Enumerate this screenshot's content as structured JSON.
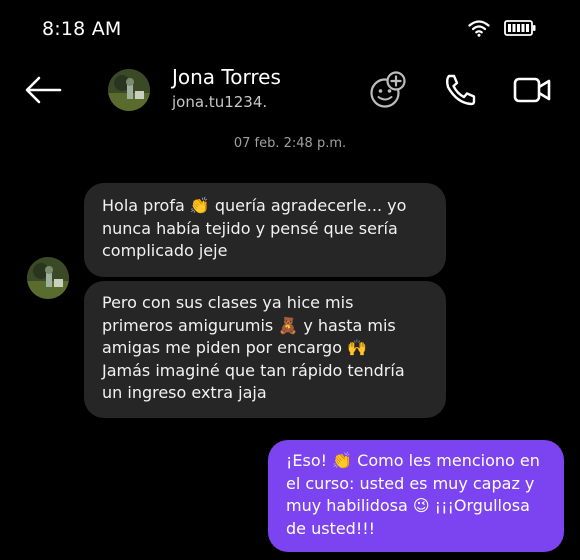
{
  "status_bar": {
    "time": "8:18 AM"
  },
  "header": {
    "name": "Jona Torres",
    "handle": "jona.tu1234."
  },
  "thread": {
    "timestamp": "07 feb. 2:48 p.m.",
    "messages": [
      {
        "sender": "incoming",
        "lines": [
          "Hola profa 👏 quería agradecerle... yo",
          "nunca había tejido y pensé que sería",
          "complicado jeje"
        ]
      },
      {
        "sender": "incoming",
        "lines": [
          "Pero con sus clases ya hice mis",
          "primeros amigurumis 🧸 y hasta mis",
          "amigas me piden por encargo 🙌",
          "Jamás imaginé que tan rápido tendría",
          "un ingreso extra jaja"
        ]
      },
      {
        "sender": "outgoing",
        "lines": [
          "¡Eso! 👏 Como les menciono en",
          "el curso: usted es muy capaz y",
          "muy habilidosa 😉 ¡¡¡Orgullosa",
          "de usted!!!"
        ]
      }
    ]
  },
  "colors": {
    "background": "#000000",
    "incoming_bubble": "#262626",
    "outgoing_bubble": "#7c44f0"
  },
  "icons": [
    "wifi-icon",
    "battery-icon",
    "back-arrow-icon",
    "add-friend-icon",
    "phone-icon",
    "video-call-icon"
  ]
}
